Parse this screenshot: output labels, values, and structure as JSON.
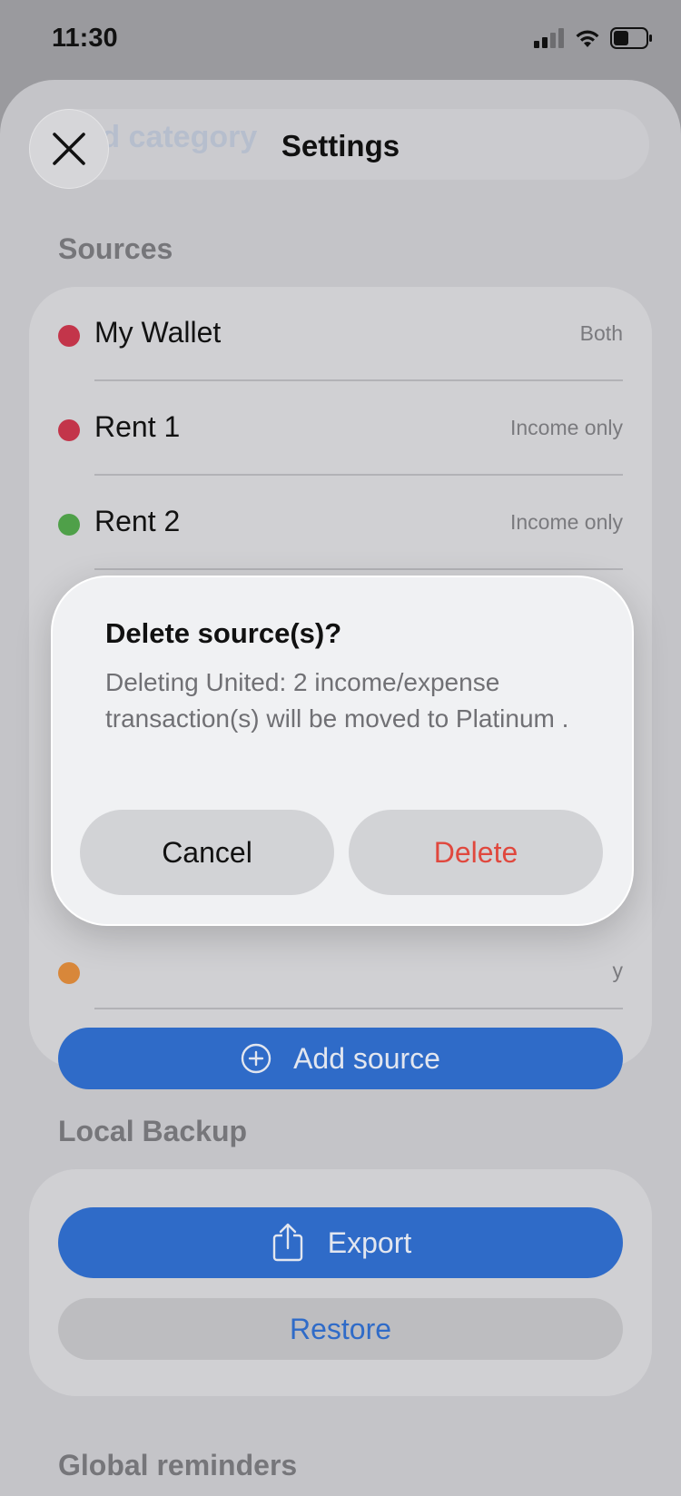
{
  "status_bar": {
    "time": "11:30"
  },
  "sheet": {
    "title": "Settings",
    "background_field_text": "Add category"
  },
  "sources": {
    "section_title": "Sources",
    "items": [
      {
        "name": "My Wallet",
        "kind": "Both",
        "color": "#c3354a"
      },
      {
        "name": "Rent 1",
        "kind": "Income only",
        "color": "#c3354a"
      },
      {
        "name": "Rent 2",
        "kind": "Income only",
        "color": "#4fa049"
      }
    ],
    "hidden_dot_colors": [
      "#5aa7d8",
      "#5aa7d8",
      "#d8873a"
    ],
    "hidden_kind_fragment": "y",
    "add_button_label": "Add source"
  },
  "local_backup": {
    "section_title": "Local Backup",
    "export_label": "Export",
    "restore_label": "Restore"
  },
  "global_reminders": {
    "section_title": "Global reminders"
  },
  "dialog": {
    "title": "Delete source(s)?",
    "message": "Deleting United: 2 income/expense transaction(s) will be moved to Platinum .",
    "cancel_label": "Cancel",
    "delete_label": "Delete"
  },
  "colors": {
    "accent_blue": "#2f6bc8",
    "destructive_red": "#e0483e"
  }
}
